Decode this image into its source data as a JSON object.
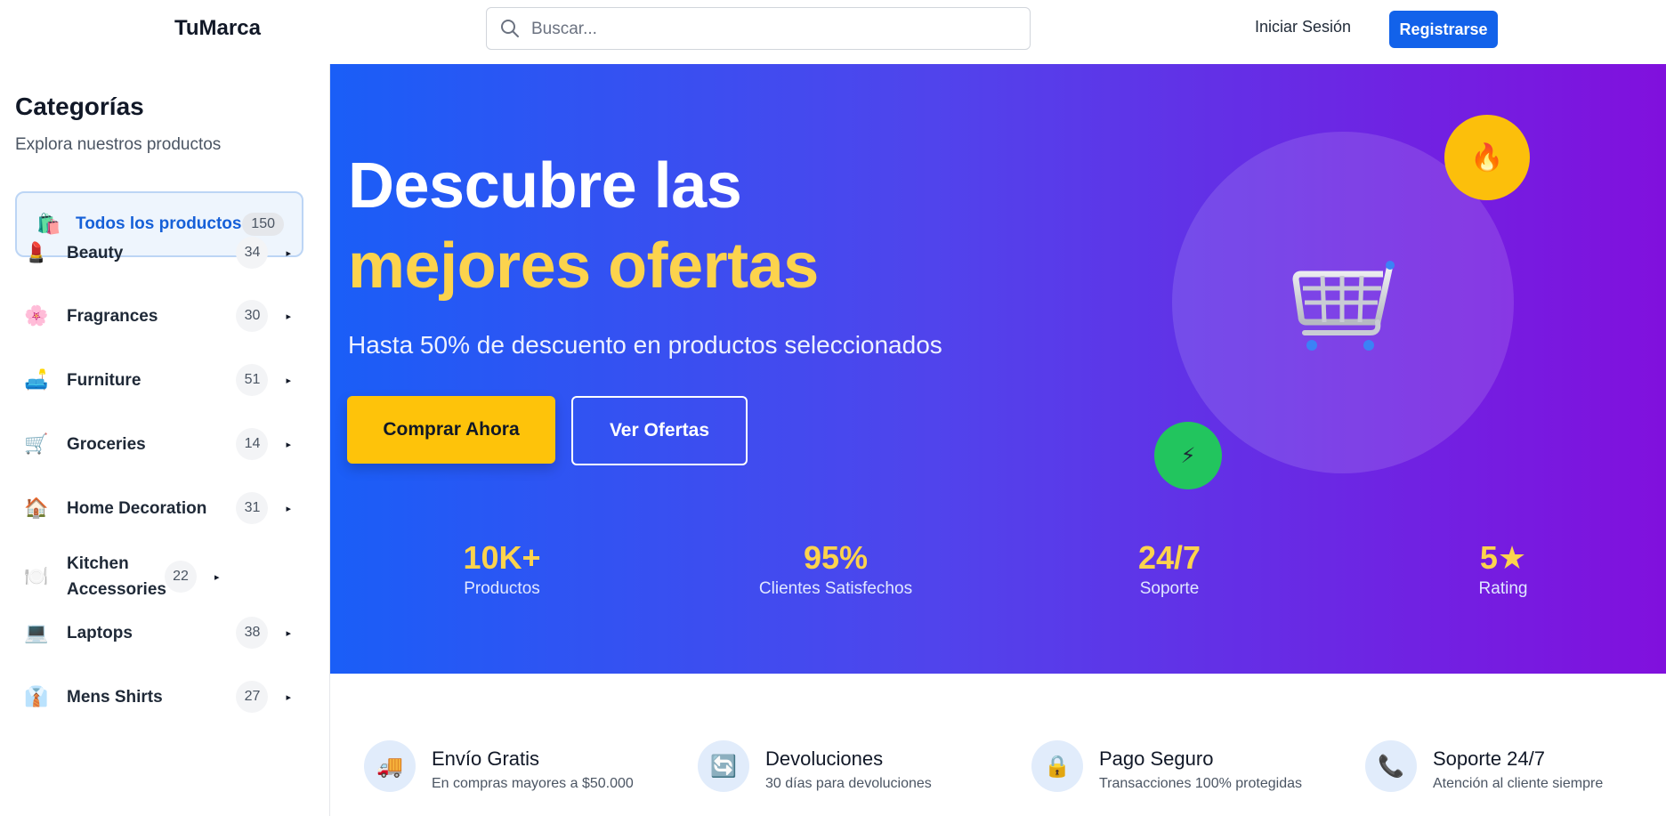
{
  "header": {
    "brand": "TuMarca",
    "search_placeholder": "Buscar...",
    "login_label": "Iniciar Sesión",
    "register_label": "Registrarse"
  },
  "sidebar": {
    "title": "Categorías",
    "subtitle": "Explora nuestros productos",
    "all": {
      "icon": "🛍️",
      "label": "Todos los productos",
      "count": "150"
    },
    "items": [
      {
        "icon": "💄",
        "label": "Beauty",
        "count": "34"
      },
      {
        "icon": "🌸",
        "label": "Fragrances",
        "count": "30"
      },
      {
        "icon": "🛋️",
        "label": "Furniture",
        "count": "51"
      },
      {
        "icon": "🛒",
        "label": "Groceries",
        "count": "14"
      },
      {
        "icon": "🏠",
        "label": "Home Decoration",
        "count": "31"
      },
      {
        "icon": "🍽️",
        "label": "Kitchen Accessories",
        "count": "22"
      },
      {
        "icon": "💻",
        "label": "Laptops",
        "count": "38"
      },
      {
        "icon": "👔",
        "label": "Mens Shirts",
        "count": "27"
      }
    ]
  },
  "hero": {
    "title_line1": "Descubre las",
    "title_line2": "mejores ofertas",
    "subtitle": "Hasta 50% de descuento en productos seleccionados",
    "buy_label": "Comprar Ahora",
    "offers_label": "Ver Ofertas",
    "fire_icon": "🔥",
    "bolt_icon": "⚡",
    "stats": [
      {
        "value": "10K+",
        "label": "Productos"
      },
      {
        "value": "95%",
        "label": "Clientes Satisfechos"
      },
      {
        "value": "24/7",
        "label": "Soporte"
      },
      {
        "value": "5★",
        "label": "Rating"
      }
    ]
  },
  "features": [
    {
      "icon": "🚚",
      "title": "Envío Gratis",
      "desc": "En compras mayores a $50.000"
    },
    {
      "icon": "🔄",
      "title": "Devoluciones",
      "desc": "30 días para devoluciones"
    },
    {
      "icon": "🔒",
      "title": "Pago Seguro",
      "desc": "Transacciones 100% protegidas"
    },
    {
      "icon": "📞",
      "title": "Soporte 24/7",
      "desc": "Atención al cliente siempre"
    }
  ],
  "colors": {
    "accent": "#1262ea",
    "hero_start": "#1a5ef7",
    "hero_end": "#8110dd",
    "highlight": "#fcd34d"
  }
}
